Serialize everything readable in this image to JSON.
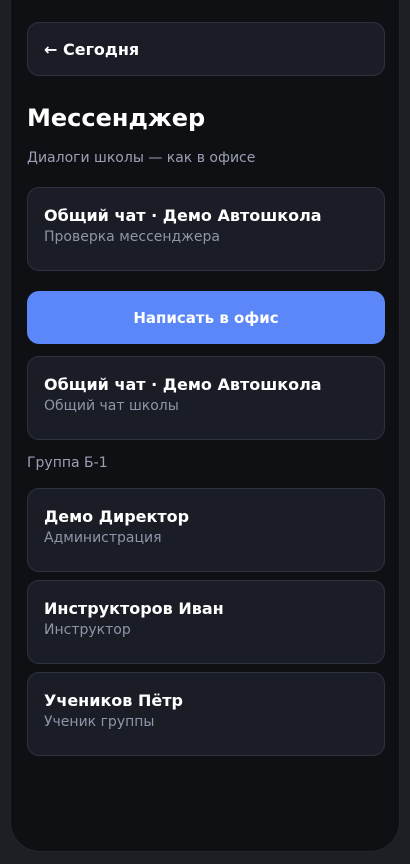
{
  "header": {
    "back_label": "← Сегодня"
  },
  "page": {
    "title": "Мессенджер",
    "subtitle": "Диалоги школы — как в офисе"
  },
  "chats_top": [
    {
      "name": "Общий чат · Демо Автошкола",
      "desc": "Проверка мессенджера"
    }
  ],
  "write_button": {
    "label": "Написать в офис"
  },
  "chats_school": [
    {
      "name": "Общий чат · Демо Автошкола",
      "desc": "Общий чат школы"
    }
  ],
  "group": {
    "label": "Группа Б-1",
    "members": [
      {
        "name": "Демо Директор",
        "desc": "Администрация"
      },
      {
        "name": "Инструкторов Иван",
        "desc": "Инструктор"
      },
      {
        "name": "Учеников Пётр",
        "desc": "Ученик группы"
      }
    ]
  },
  "colors": {
    "accent": "#5b87f8",
    "background": "#0f1014",
    "card": "#1b1d26",
    "muted_text": "#9aa0b4"
  }
}
